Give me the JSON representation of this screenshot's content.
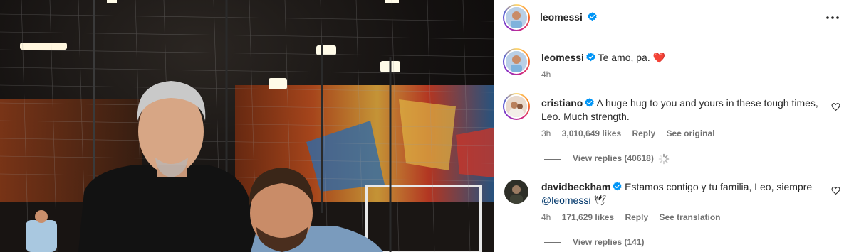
{
  "post": {
    "author": "leomessi",
    "more_icon": "more-horizontal-icon"
  },
  "comments": [
    {
      "username": "leomessi",
      "verified": true,
      "text": "Te amo, pa.",
      "emoji": "❤️",
      "time": "4h"
    },
    {
      "username": "cristiano",
      "verified": true,
      "text_line1": "A huge hug to you and yours in these tough times,",
      "text_line2": "Leo. Much strength.",
      "time": "3h",
      "likes": "3,010,649 likes",
      "reply": "Reply",
      "extra": "See original",
      "view_replies": "View replies (40618)"
    },
    {
      "username": "davidbeckham",
      "verified": true,
      "text_line1": "Estamos contigo y tu familia, Leo, siempre",
      "mention": "@leomessi",
      "emoji": "🕊",
      "time": "4h",
      "likes": "171,629 likes",
      "reply": "Reply",
      "extra": "See translation",
      "view_replies": "View replies (141)"
    }
  ],
  "colors": {
    "verified_blue": "#0095f6",
    "text": "#262626",
    "muted": "#737373",
    "heart_red": "#ff3040",
    "mention": "#00376b"
  }
}
